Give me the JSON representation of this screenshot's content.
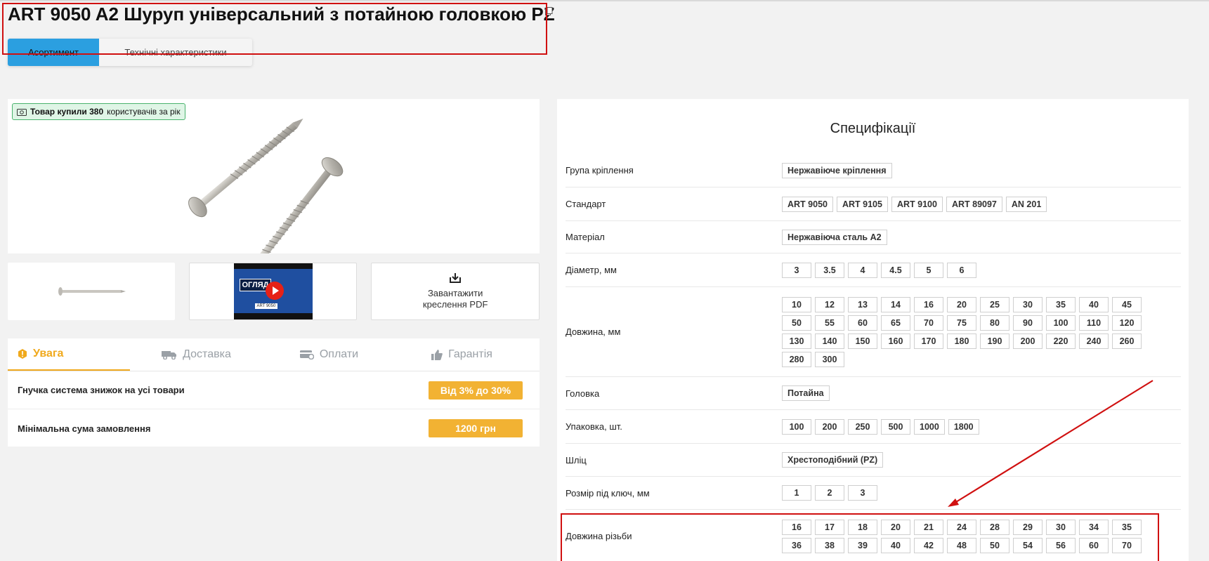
{
  "page": {
    "title": "ART 9050 A2 Шуруп універсальний з потайною головкою PZ",
    "tabs": [
      "Асортимент",
      "Технічні характеристики"
    ]
  },
  "media": {
    "buyers_badge": {
      "prefix": "Товар купили 380",
      "suffix": "користувачів за рік"
    },
    "video_caption": "ОГЛЯД",
    "video_code": "ART 9050",
    "pdf_label": "Завантажити креслення PDF"
  },
  "info": {
    "tabs": [
      {
        "label": "Увага",
        "icon": "warning-icon"
      },
      {
        "label": "Доставка",
        "icon": "truck-icon"
      },
      {
        "label": "Оплати",
        "icon": "payment-icon"
      },
      {
        "label": "Гарантія",
        "icon": "thumbs-up-icon"
      }
    ],
    "rows": [
      {
        "label": "Гнучка система знижок на усі товари",
        "value": "Від 3% до 30%"
      },
      {
        "label": "Мінімальна сума замовлення",
        "value": "1200 грн"
      }
    ]
  },
  "specs": {
    "title": "Специфікації",
    "rows": [
      {
        "label": "Група кріплення",
        "values": [
          "Нержавіюче кріплення"
        ]
      },
      {
        "label": "Стандарт",
        "values": [
          "ART 9050",
          "ART 9105",
          "ART 9100",
          "ART 89097",
          "AN 201"
        ]
      },
      {
        "label": "Матеріал",
        "values": [
          "Нержавіюча сталь A2"
        ]
      },
      {
        "label": "Діаметр, мм",
        "values": [
          "3",
          "3.5",
          "4",
          "4.5",
          "5",
          "6"
        ]
      },
      {
        "label": "Довжина, мм",
        "values": [
          "10",
          "12",
          "13",
          "14",
          "16",
          "20",
          "25",
          "30",
          "35",
          "40",
          "45",
          "50",
          "55",
          "60",
          "65",
          "70",
          "75",
          "80",
          "90",
          "100",
          "110",
          "120",
          "130",
          "140",
          "150",
          "160",
          "170",
          "180",
          "190",
          "200",
          "220",
          "240",
          "260",
          "280",
          "300"
        ]
      },
      {
        "label": "Головка",
        "values": [
          "Потайна"
        ]
      },
      {
        "label": "Упаковка, шт.",
        "values": [
          "100",
          "200",
          "250",
          "500",
          "1000",
          "1800"
        ]
      },
      {
        "label": "Шліц",
        "values": [
          "Хрестоподібний (PZ)"
        ]
      },
      {
        "label": "Розмір під ключ, мм",
        "values": [
          "1",
          "2",
          "3"
        ]
      },
      {
        "label": "Довжина різьби",
        "values": [
          "16",
          "17",
          "18",
          "20",
          "21",
          "24",
          "28",
          "29",
          "30",
          "34",
          "35",
          "36",
          "38",
          "39",
          "40",
          "42",
          "48",
          "50",
          "54",
          "56",
          "60",
          "70"
        ]
      }
    ]
  },
  "colors": {
    "accent": "#2b9fe0",
    "warning": "#f0a91c",
    "highlight": "#d01010",
    "badge_bg": "#dff5e6"
  }
}
